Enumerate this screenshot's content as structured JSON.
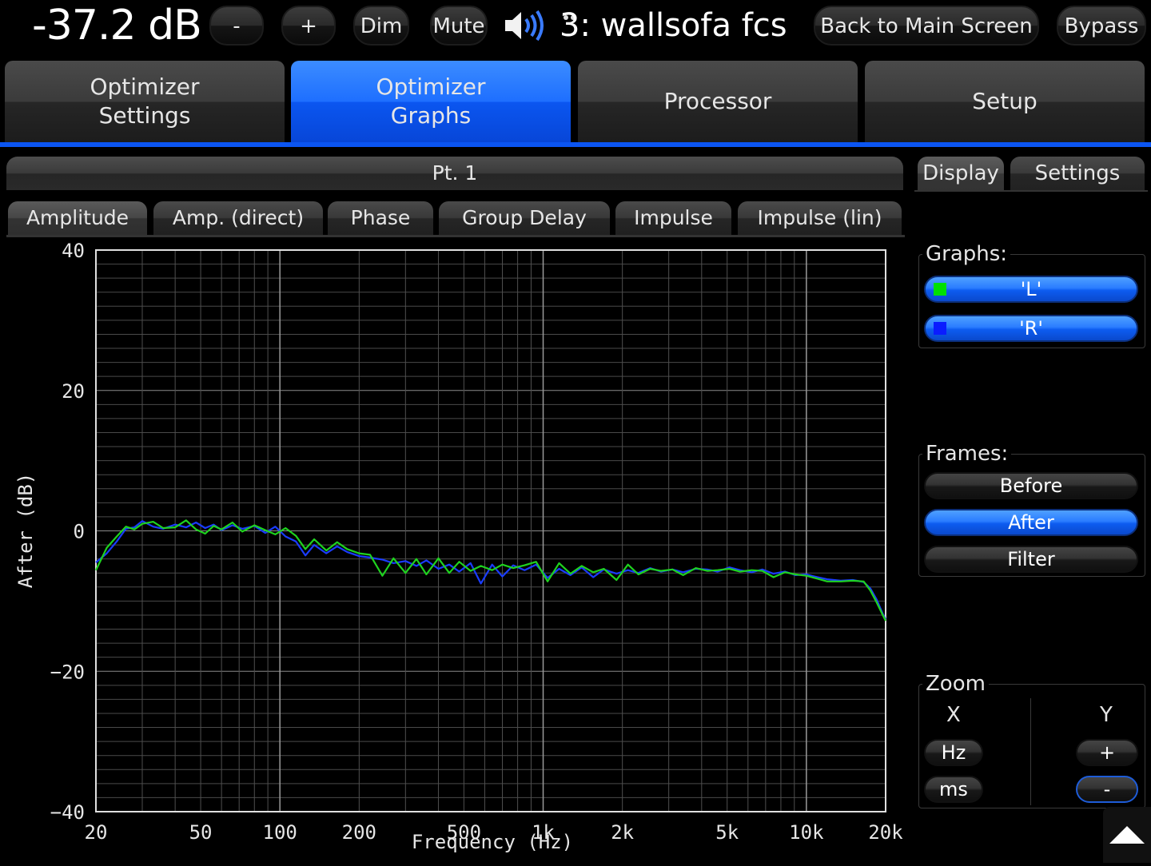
{
  "topbar": {
    "volume": "-37.2 dB",
    "minus_label": "-",
    "plus_label": "+",
    "dim_label": "Dim",
    "mute_label": "Mute",
    "preset": "3: wallsofa fcs",
    "back_label": "Back to Main Screen",
    "bypass_label": "Bypass"
  },
  "tabs": [
    {
      "label": "Optimizer\nSettings",
      "active": false
    },
    {
      "label": "Optimizer\nGraphs",
      "active": true
    },
    {
      "label": "Processor",
      "active": false
    },
    {
      "label": "Setup",
      "active": false
    }
  ],
  "section_title": "Pt. 1",
  "subtabs": [
    "Amplitude",
    "Amp. (direct)",
    "Phase",
    "Group Delay",
    "Impulse",
    "Impulse (lin)"
  ],
  "right_tabs": [
    "Display",
    "Settings"
  ],
  "graphs_group": {
    "title": "Graphs:",
    "items": [
      {
        "label": "'L'",
        "color": "#00e000"
      },
      {
        "label": "'R'",
        "color": "#0a1cff"
      }
    ]
  },
  "frames_group": {
    "title": "Frames:",
    "items": [
      {
        "label": "Before",
        "active": false
      },
      {
        "label": "After",
        "active": true
      },
      {
        "label": "Filter",
        "active": false
      }
    ]
  },
  "zoom_group": {
    "title": "Zoom",
    "x_label": "X",
    "y_label": "Y",
    "hz_label": "Hz",
    "ms_label": "ms",
    "yplus_label": "+",
    "yminus_label": "-"
  },
  "chart_data": {
    "type": "line",
    "xlabel": "Frequency (Hz)",
    "ylabel": "After (dB)",
    "xscale": "log",
    "xlim": [
      20,
      20000
    ],
    "ylim": [
      -40,
      40
    ],
    "xticks": [
      20,
      50,
      100,
      200,
      500,
      1000,
      2000,
      5000,
      10000,
      20000
    ],
    "xtick_labels": [
      "20",
      "50",
      "100",
      "200",
      "500",
      "1k",
      "2k",
      "5k",
      "10k",
      "20k"
    ],
    "yticks": [
      40,
      20,
      0,
      -20,
      -40
    ],
    "ytick_labels": [
      "40",
      "20",
      "0",
      "−20",
      "−40"
    ],
    "grid": true,
    "series": [
      {
        "name": "'R'",
        "color": "#1a3cff",
        "x": [
          20,
          22,
          24,
          26,
          28,
          30,
          33,
          36,
          40,
          44,
          48,
          52,
          56,
          60,
          66,
          72,
          80,
          88,
          96,
          105,
          115,
          125,
          135,
          150,
          165,
          180,
          200,
          220,
          245,
          270,
          300,
          330,
          360,
          400,
          440,
          480,
          530,
          580,
          640,
          700,
          770,
          850,
          940,
          1040,
          1150,
          1270,
          1400,
          1550,
          1700,
          1900,
          2100,
          2300,
          2550,
          2800,
          3100,
          3400,
          3800,
          4200,
          4600,
          5100,
          5600,
          6200,
          6800,
          7500,
          8300,
          9100,
          10000,
          11000,
          12000,
          13500,
          15000,
          16500,
          17500,
          18500,
          19500,
          20000
        ],
        "y": [
          -4.5,
          -3.2,
          -1.5,
          0.3,
          0.5,
          1.4,
          0.6,
          0.3,
          0.9,
          0.5,
          1.2,
          0.4,
          0.9,
          0.1,
          0.8,
          0.3,
          0.7,
          -0.3,
          0.6,
          -0.8,
          -1.5,
          -3.5,
          -2.0,
          -3.2,
          -2.2,
          -3.0,
          -3.6,
          -3.8,
          -4.1,
          -4.6,
          -4.3,
          -5.0,
          -4.2,
          -5.4,
          -4.8,
          -5.8,
          -4.6,
          -7.5,
          -4.8,
          -6.5,
          -4.9,
          -5.6,
          -4.8,
          -6.7,
          -5.4,
          -6.3,
          -5.2,
          -6.6,
          -5.5,
          -6.1,
          -5.6,
          -6.0,
          -5.3,
          -5.8,
          -5.5,
          -5.9,
          -5.4,
          -5.5,
          -5.8,
          -5.2,
          -5.6,
          -5.9,
          -5.5,
          -6.1,
          -5.8,
          -6.3,
          -6.2,
          -6.6,
          -6.9,
          -7.1,
          -7.0,
          -7.3,
          -8.2,
          -9.8,
          -11.8,
          -12.6
        ]
      },
      {
        "name": "'L'",
        "color": "#1fd21f",
        "x": [
          20,
          22,
          24,
          26,
          28,
          30,
          33,
          36,
          40,
          44,
          48,
          52,
          56,
          60,
          66,
          72,
          80,
          88,
          96,
          105,
          115,
          125,
          135,
          150,
          165,
          180,
          200,
          220,
          245,
          270,
          300,
          330,
          360,
          400,
          440,
          480,
          530,
          580,
          640,
          700,
          770,
          850,
          940,
          1040,
          1150,
          1270,
          1400,
          1550,
          1700,
          1900,
          2100,
          2300,
          2550,
          2800,
          3100,
          3400,
          3800,
          4200,
          4600,
          5100,
          5600,
          6200,
          6800,
          7500,
          8300,
          9100,
          10000,
          11000,
          12000,
          13500,
          15000,
          16500,
          17500,
          18500,
          19500,
          20000
        ],
        "y": [
          -5.6,
          -2.4,
          -0.8,
          0.6,
          0.2,
          1.0,
          1.3,
          0.4,
          0.5,
          1.5,
          0.2,
          -0.4,
          0.7,
          0.2,
          1.2,
          -0.1,
          0.8,
          0.1,
          -0.5,
          0.4,
          -0.7,
          -2.6,
          -1.2,
          -2.8,
          -1.6,
          -2.6,
          -3.2,
          -3.4,
          -6.4,
          -3.9,
          -6.0,
          -4.0,
          -6.2,
          -3.9,
          -6.0,
          -4.4,
          -5.7,
          -5.0,
          -5.6,
          -4.8,
          -5.3,
          -4.9,
          -4.4,
          -7.2,
          -4.6,
          -6.1,
          -5.0,
          -5.9,
          -5.4,
          -7.0,
          -4.8,
          -6.2,
          -5.4,
          -5.7,
          -5.5,
          -6.3,
          -5.3,
          -5.7,
          -5.6,
          -5.4,
          -5.8,
          -5.6,
          -5.7,
          -6.6,
          -5.9,
          -6.2,
          -6.4,
          -6.8,
          -7.2,
          -7.2,
          -7.1,
          -7.2,
          -8.5,
          -10.2,
          -12.0,
          -12.8
        ]
      }
    ]
  }
}
